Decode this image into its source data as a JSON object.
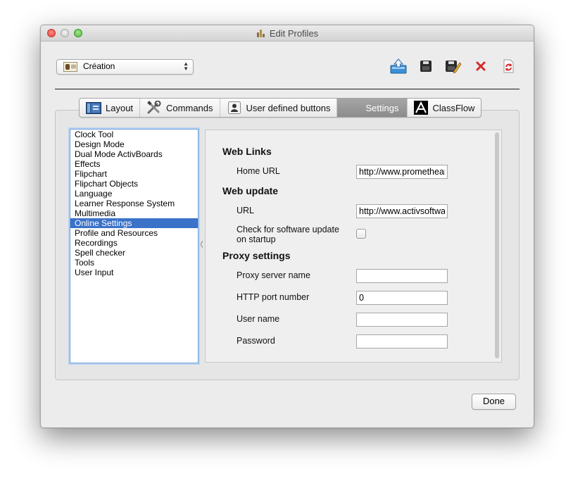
{
  "window": {
    "title": "Edit Profiles"
  },
  "profile": {
    "selected": "Création"
  },
  "toolbar": {
    "buttons": [
      "export-icon",
      "save-icon",
      "save-as-icon",
      "delete-icon",
      "refresh-icon"
    ],
    "colors": {
      "blue": "#3a8fd6",
      "dark": "#2b2b2b",
      "red": "#d42b2b"
    }
  },
  "tabs": [
    {
      "label": "Layout",
      "icon": "layout-icon",
      "active": false
    },
    {
      "label": "Commands",
      "icon": "tools-icon",
      "active": false
    },
    {
      "label": "User defined buttons",
      "icon": "user-icon",
      "active": false
    },
    {
      "label": "Settings",
      "icon": "",
      "active": true
    },
    {
      "label": "ClassFlow",
      "icon": "classflow-icon",
      "active": false
    }
  ],
  "categories": [
    "Clock Tool",
    "Design Mode",
    "Dual Mode ActivBoards",
    "Effects",
    "Flipchart",
    "Flipchart Objects",
    "Language",
    "Learner Response System",
    "Multimedia",
    "Online Settings",
    "Profile and Resources",
    "Recordings",
    "Spell checker",
    "Tools",
    "User Input"
  ],
  "selected_category": "Online Settings",
  "settings": {
    "web_links": {
      "heading": "Web Links",
      "home_url_label": "Home URL",
      "home_url_value": "http://www.prometheanplanet.com"
    },
    "web_update": {
      "heading": "Web update",
      "url_label": "URL",
      "url_value": "http://www.activsoftware.co.uk",
      "check_label_1": "Check for software update",
      "check_label_2": "on startup",
      "check_value": false
    },
    "proxy": {
      "heading": "Proxy settings",
      "server_label": "Proxy server name",
      "server_value": "",
      "port_label": "HTTP port number",
      "port_value": "0",
      "user_label": "User name",
      "user_value": "",
      "password_label": "Password",
      "password_value": ""
    }
  },
  "footer": {
    "done_label": "Done"
  }
}
